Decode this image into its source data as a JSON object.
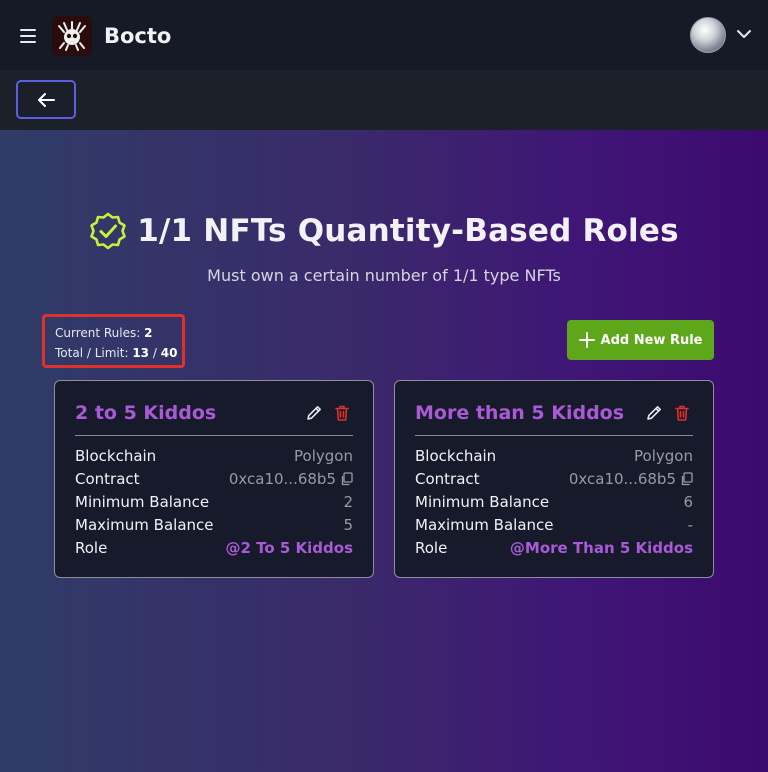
{
  "header": {
    "app_name": "Bocto",
    "icons": {
      "menu": "hamburger-menu-icon",
      "logo": "bocto-logo",
      "avatar": "user-avatar",
      "dropdown": "chevron-down-icon"
    }
  },
  "nav": {
    "back_icon": "arrow-left-icon"
  },
  "page": {
    "title": "1/1 NFTs Quantity-Based Roles",
    "title_icon": "verified-badge-icon",
    "subtitle": "Must own a certain number of 1/1 type NFTs"
  },
  "stats": {
    "current_rules_label": "Current Rules:",
    "current_rules_value": "2",
    "total_limit_label": "Total / Limit:",
    "total_value": "13",
    "separator": "/",
    "limit_value": "40"
  },
  "add_button": {
    "label": "Add New Rule",
    "icon": "plus-icon"
  },
  "colors": {
    "accent_purple": "#a95ad6",
    "add_green": "#5ea71b",
    "delete_red": "#e0302a",
    "back_border": "#5b5fe0"
  },
  "rules": [
    {
      "title": "2 to 5 Kiddos",
      "rows": [
        {
          "label": "Blockchain",
          "value": "Polygon"
        },
        {
          "label": "Contract",
          "value": "0xca10...68b5"
        },
        {
          "label": "Minimum Balance",
          "value": "2"
        },
        {
          "label": "Maximum Balance",
          "value": "5"
        },
        {
          "label": "Role",
          "value": "@2 To 5 Kiddos"
        }
      ]
    },
    {
      "title": "More than 5 Kiddos",
      "rows": [
        {
          "label": "Blockchain",
          "value": "Polygon"
        },
        {
          "label": "Contract",
          "value": "0xca10...68b5"
        },
        {
          "label": "Minimum Balance",
          "value": "6"
        },
        {
          "label": "Maximum Balance",
          "value": "-"
        },
        {
          "label": "Role",
          "value": "@More Than 5 Kiddos"
        }
      ]
    }
  ]
}
